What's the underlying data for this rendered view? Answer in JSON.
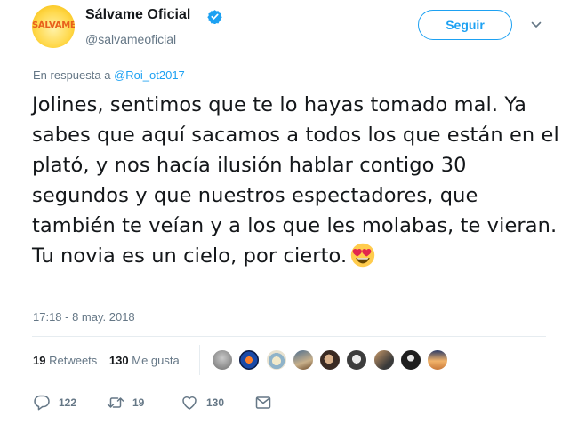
{
  "account": {
    "display_name": "Sálvame Oficial",
    "handle": "@salvameoficial",
    "avatar_text": "SÁLVAME",
    "verified": true
  },
  "follow_button": {
    "label": "Seguir"
  },
  "reply_context": {
    "prefix": "En respuesta a",
    "mention": "@Roi_ot2017"
  },
  "tweet": {
    "text": "Jolines, sentimos que te lo hayas tomado mal. Ya sabes que aquí sacamos a todos los que están en el plató, y nos hacía ilusión hablar contigo 30 segundos y que nuestros espectadores, que también te veían y a los que les molabas, te vieran. Tu novia es un cielo, por cierto.",
    "emoji": "heart-eyes-emoji",
    "timestamp": "17:18 - 8 may. 2018"
  },
  "stats": {
    "retweets_count": "19",
    "retweets_label": "Retweets",
    "likes_count": "130",
    "likes_label": "Me gusta"
  },
  "actions": {
    "reply_count": "122",
    "retweet_count": "19",
    "like_count": "130"
  },
  "icons": [
    "verified-badge-icon",
    "chevron-down-icon",
    "reply-icon",
    "retweet-icon",
    "heart-icon",
    "envelope-icon"
  ],
  "colors": {
    "accent": "#1da1f2",
    "secondary_text": "#657786",
    "primary_text": "#14171a",
    "divider": "#e6ecf0"
  }
}
